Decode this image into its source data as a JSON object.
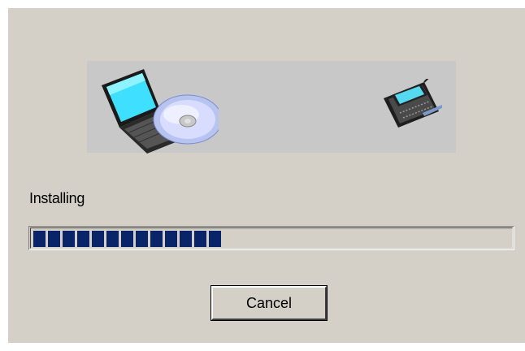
{
  "window": {
    "background_color": "#d4d0c8"
  },
  "banner": {
    "left_icon": "laptop-with-cd-icon",
    "right_icon": "handheld-device-icon"
  },
  "status": {
    "label": "Installing"
  },
  "progress": {
    "fraction": 0.41,
    "color": "#0a246a"
  },
  "buttons": {
    "cancel_label": "Cancel"
  }
}
